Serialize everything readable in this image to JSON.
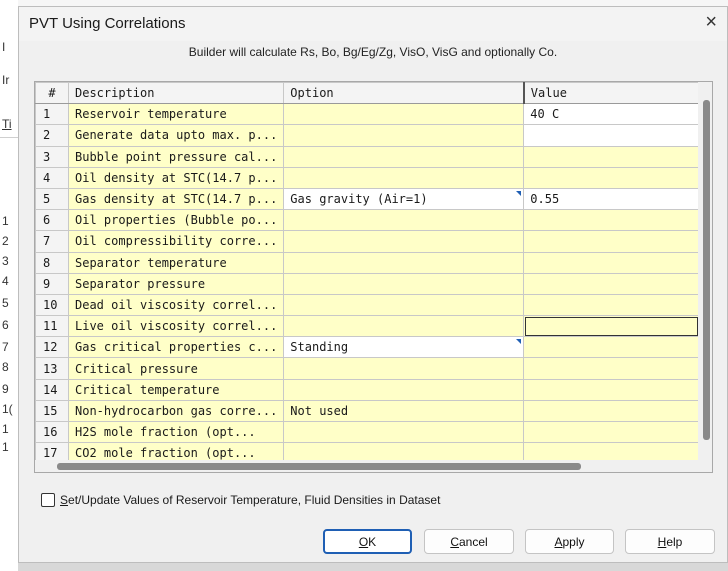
{
  "background": {
    "edge_chars": [
      "I",
      "Ir",
      "Ti",
      "1",
      "1",
      "2",
      "3",
      "4",
      "5",
      "6",
      "7",
      "8",
      "9",
      "1(",
      "1",
      "1"
    ]
  },
  "dialog": {
    "title": "PVT Using Correlations",
    "close_symbol": "×",
    "subtitle": "Builder will calculate Rs, Bo, Bg/Eg/Zg, VisO, VisG and optionally Co."
  },
  "grid": {
    "headers": {
      "num": "#",
      "description": "Description",
      "option": "Option",
      "value": "Value"
    },
    "rows": [
      {
        "num": "1",
        "description": "Reservoir temperature",
        "option": "",
        "value": "40 C"
      },
      {
        "num": "2",
        "description": "Generate data upto max. p...",
        "option": "",
        "value": ""
      },
      {
        "num": "3",
        "description": "Bubble point pressure cal...",
        "option": "",
        "value": ""
      },
      {
        "num": "4",
        "description": "Oil density at STC(14.7 p...",
        "option": "",
        "value": ""
      },
      {
        "num": "5",
        "description": "Gas density at STC(14.7 p...",
        "option": "Gas gravity (Air=1)",
        "value": "0.55"
      },
      {
        "num": "6",
        "description": "Oil properties (Bubble po...",
        "option": "",
        "value": ""
      },
      {
        "num": "7",
        "description": "Oil compressibility corre...",
        "option": "",
        "value": ""
      },
      {
        "num": "8",
        "description": "Separator temperature",
        "option": "",
        "value": ""
      },
      {
        "num": "9",
        "description": "Separator pressure",
        "option": "",
        "value": ""
      },
      {
        "num": "10",
        "description": "Dead oil viscosity correl...",
        "option": "",
        "value": ""
      },
      {
        "num": "11",
        "description": "Live oil viscosity correl...",
        "option": "",
        "value": ""
      },
      {
        "num": "12",
        "description": "Gas critical properties c...",
        "option": "Standing",
        "value": ""
      },
      {
        "num": "13",
        "description": "Critical pressure",
        "option": "",
        "value": ""
      },
      {
        "num": "14",
        "description": "Critical temperature",
        "option": "",
        "value": ""
      },
      {
        "num": "15",
        "description": "Non-hydrocarbon gas corre...",
        "option": "Not used",
        "value": ""
      },
      {
        "num": "16",
        "description": "H2S mole fraction (opt...",
        "option": "",
        "value": ""
      },
      {
        "num": "17",
        "description": "CO2 mole fraction (opt...",
        "option": "",
        "value": ""
      }
    ]
  },
  "checkbox": {
    "label_mnemonic": "S",
    "label_rest": "et/Update Values of Reservoir Temperature, Fluid Densities in Dataset",
    "checked": false
  },
  "buttons": {
    "ok": {
      "mnemonic": "O",
      "rest": "K"
    },
    "cancel": {
      "mnemonic": "C",
      "rest": "ancel"
    },
    "apply": {
      "mnemonic": "A",
      "rest": "pply"
    },
    "help": {
      "mnemonic": "H",
      "rest": "elp"
    }
  },
  "colors": {
    "cell_yellow": "#ffffc8",
    "accent": "#1f5fb4"
  }
}
